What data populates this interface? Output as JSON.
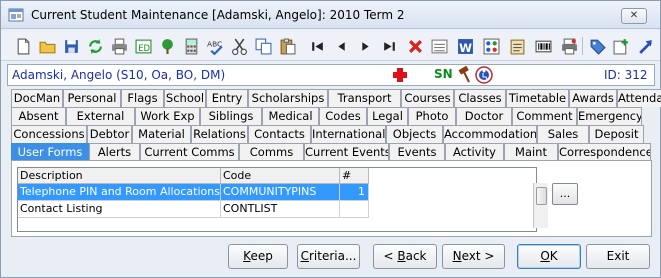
{
  "window": {
    "title": "Current Student Maintenance  [Adamski, Angelo]: 2010 Term 2",
    "close_symbol": "✕"
  },
  "student": {
    "name": "Adamski, Angelo (S10, Oa, BO, DM)",
    "sn_label": "SN",
    "id_label": "ID: 312"
  },
  "tabs": {
    "row1": [
      "DocMan",
      "Personal",
      "Flags",
      "School",
      "Entry",
      "Scholarships",
      "Transport",
      "Courses",
      "Classes",
      "Timetable",
      "Awards",
      "Attendance"
    ],
    "row2": [
      "Absent",
      "External",
      "Work Exp",
      "Siblings",
      "Medical",
      "Codes",
      "Legal",
      "Photo",
      "Doctor",
      "Comment",
      "Emergency"
    ],
    "row3": [
      "Concessions",
      "Debtor",
      "Material",
      "Relations",
      "Contacts",
      "International",
      "Objects",
      "Accommodation",
      "Sales",
      "Deposit"
    ],
    "row4": [
      "User Forms",
      "Alerts",
      "Current Comms",
      "Comms",
      "Current Events",
      "Events",
      "Activity",
      "Maint",
      "Correspondence"
    ],
    "active": "User Forms"
  },
  "grid": {
    "columns": [
      "Description",
      "Code",
      "#"
    ],
    "rows": [
      {
        "description": "Telephone PIN and Room Allocations",
        "code": "COMMUNITYPINS",
        "count": "1",
        "selected": true
      },
      {
        "description": "Contact Listing",
        "code": "CONTLIST",
        "count": "",
        "selected": false
      }
    ]
  },
  "ellipsis_label": "...",
  "buttons": {
    "keep": {
      "pre": "",
      "ul": "K",
      "post": "eep"
    },
    "criteria": {
      "pre": "",
      "ul": "C",
      "post": "riteria..."
    },
    "back": {
      "pre": "< ",
      "ul": "B",
      "post": "ack"
    },
    "next": {
      "pre": "",
      "ul": "N",
      "post": "ext >"
    },
    "ok": {
      "pre": "",
      "ul": "O",
      "post": "K"
    },
    "exit": {
      "pre": "E",
      "ul": "",
      "post": "xit"
    }
  },
  "colors": {
    "accent": "#3b8fe6",
    "selection": "#3399ff",
    "student_text": "#1a2eb0"
  }
}
